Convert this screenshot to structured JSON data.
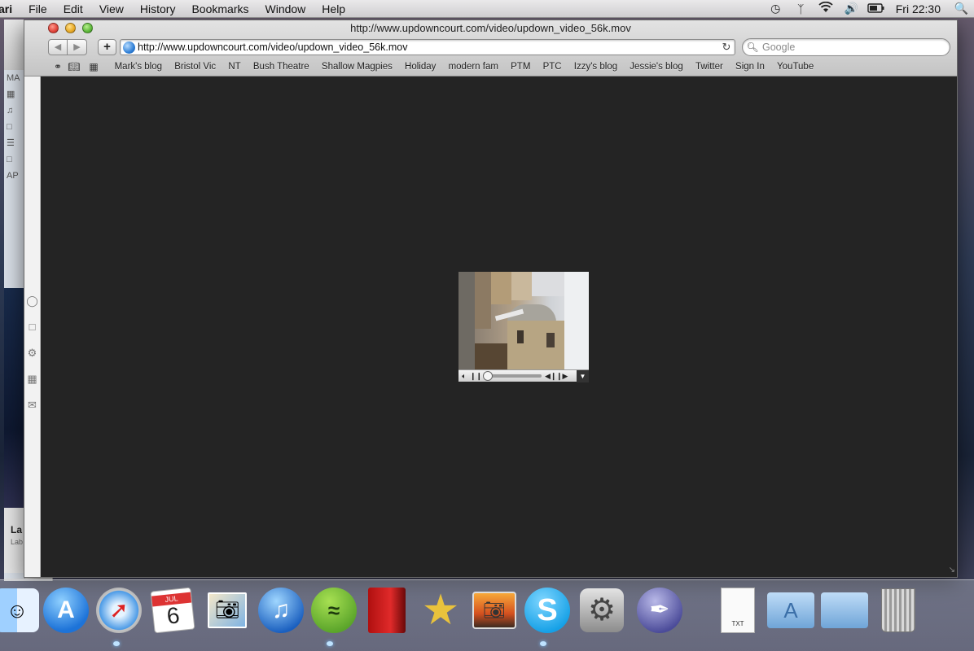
{
  "menubar": {
    "app_name": "ari",
    "menus": [
      "File",
      "Edit",
      "View",
      "History",
      "Bookmarks",
      "Window",
      "Help"
    ],
    "status_icons": [
      "time-machine-icon",
      "bluetooth-icon",
      "wifi-icon",
      "volume-icon",
      "battery-icon"
    ],
    "clock": "Fri 22:30",
    "spotlight_icon": "spotlight-search-icon"
  },
  "background_window": {
    "sidebar_header": "MA",
    "section_header": "AP",
    "bottom_title": "La",
    "bottom_subtitle": "Lab"
  },
  "browser": {
    "window_title": "http://www.updowncourt.com/video/updown_video_56k.mov",
    "url": "http://www.updowncourt.com/video/updown_video_56k.mov",
    "search_placeholder": "Google",
    "bookmarks": [
      "Mark's blog",
      "Bristol Vic",
      "NT",
      "Bush Theatre",
      "Shallow Magpies",
      "Holiday",
      "modern fam",
      "PTM",
      "PTC",
      "Izzy's blog",
      "Jessie's blog",
      "Twitter",
      "Sign In",
      "YouTube"
    ]
  },
  "video": {
    "progress": 0.0,
    "controls": [
      "volume-icon",
      "pause-icon",
      "scrubber",
      "step-back-icon",
      "step-forward-icon",
      "options-menu-icon"
    ]
  },
  "dock": {
    "items": [
      "finder",
      "app-store",
      "safari",
      "calendar",
      "iphoto",
      "itunes",
      "spotify",
      "photo-booth",
      "imovie",
      "image-capture",
      "skype",
      "system-preferences",
      "ibooks",
      "txt-document",
      "applications-folder",
      "documents-folder",
      "trash"
    ],
    "calendar_month": "JUL",
    "calendar_day": "6",
    "document_label": "TXT"
  },
  "colors": {
    "content_background": "#242424",
    "toolbar_top": "#e3e3e3",
    "toolbar_bottom": "#c4c4c4"
  }
}
